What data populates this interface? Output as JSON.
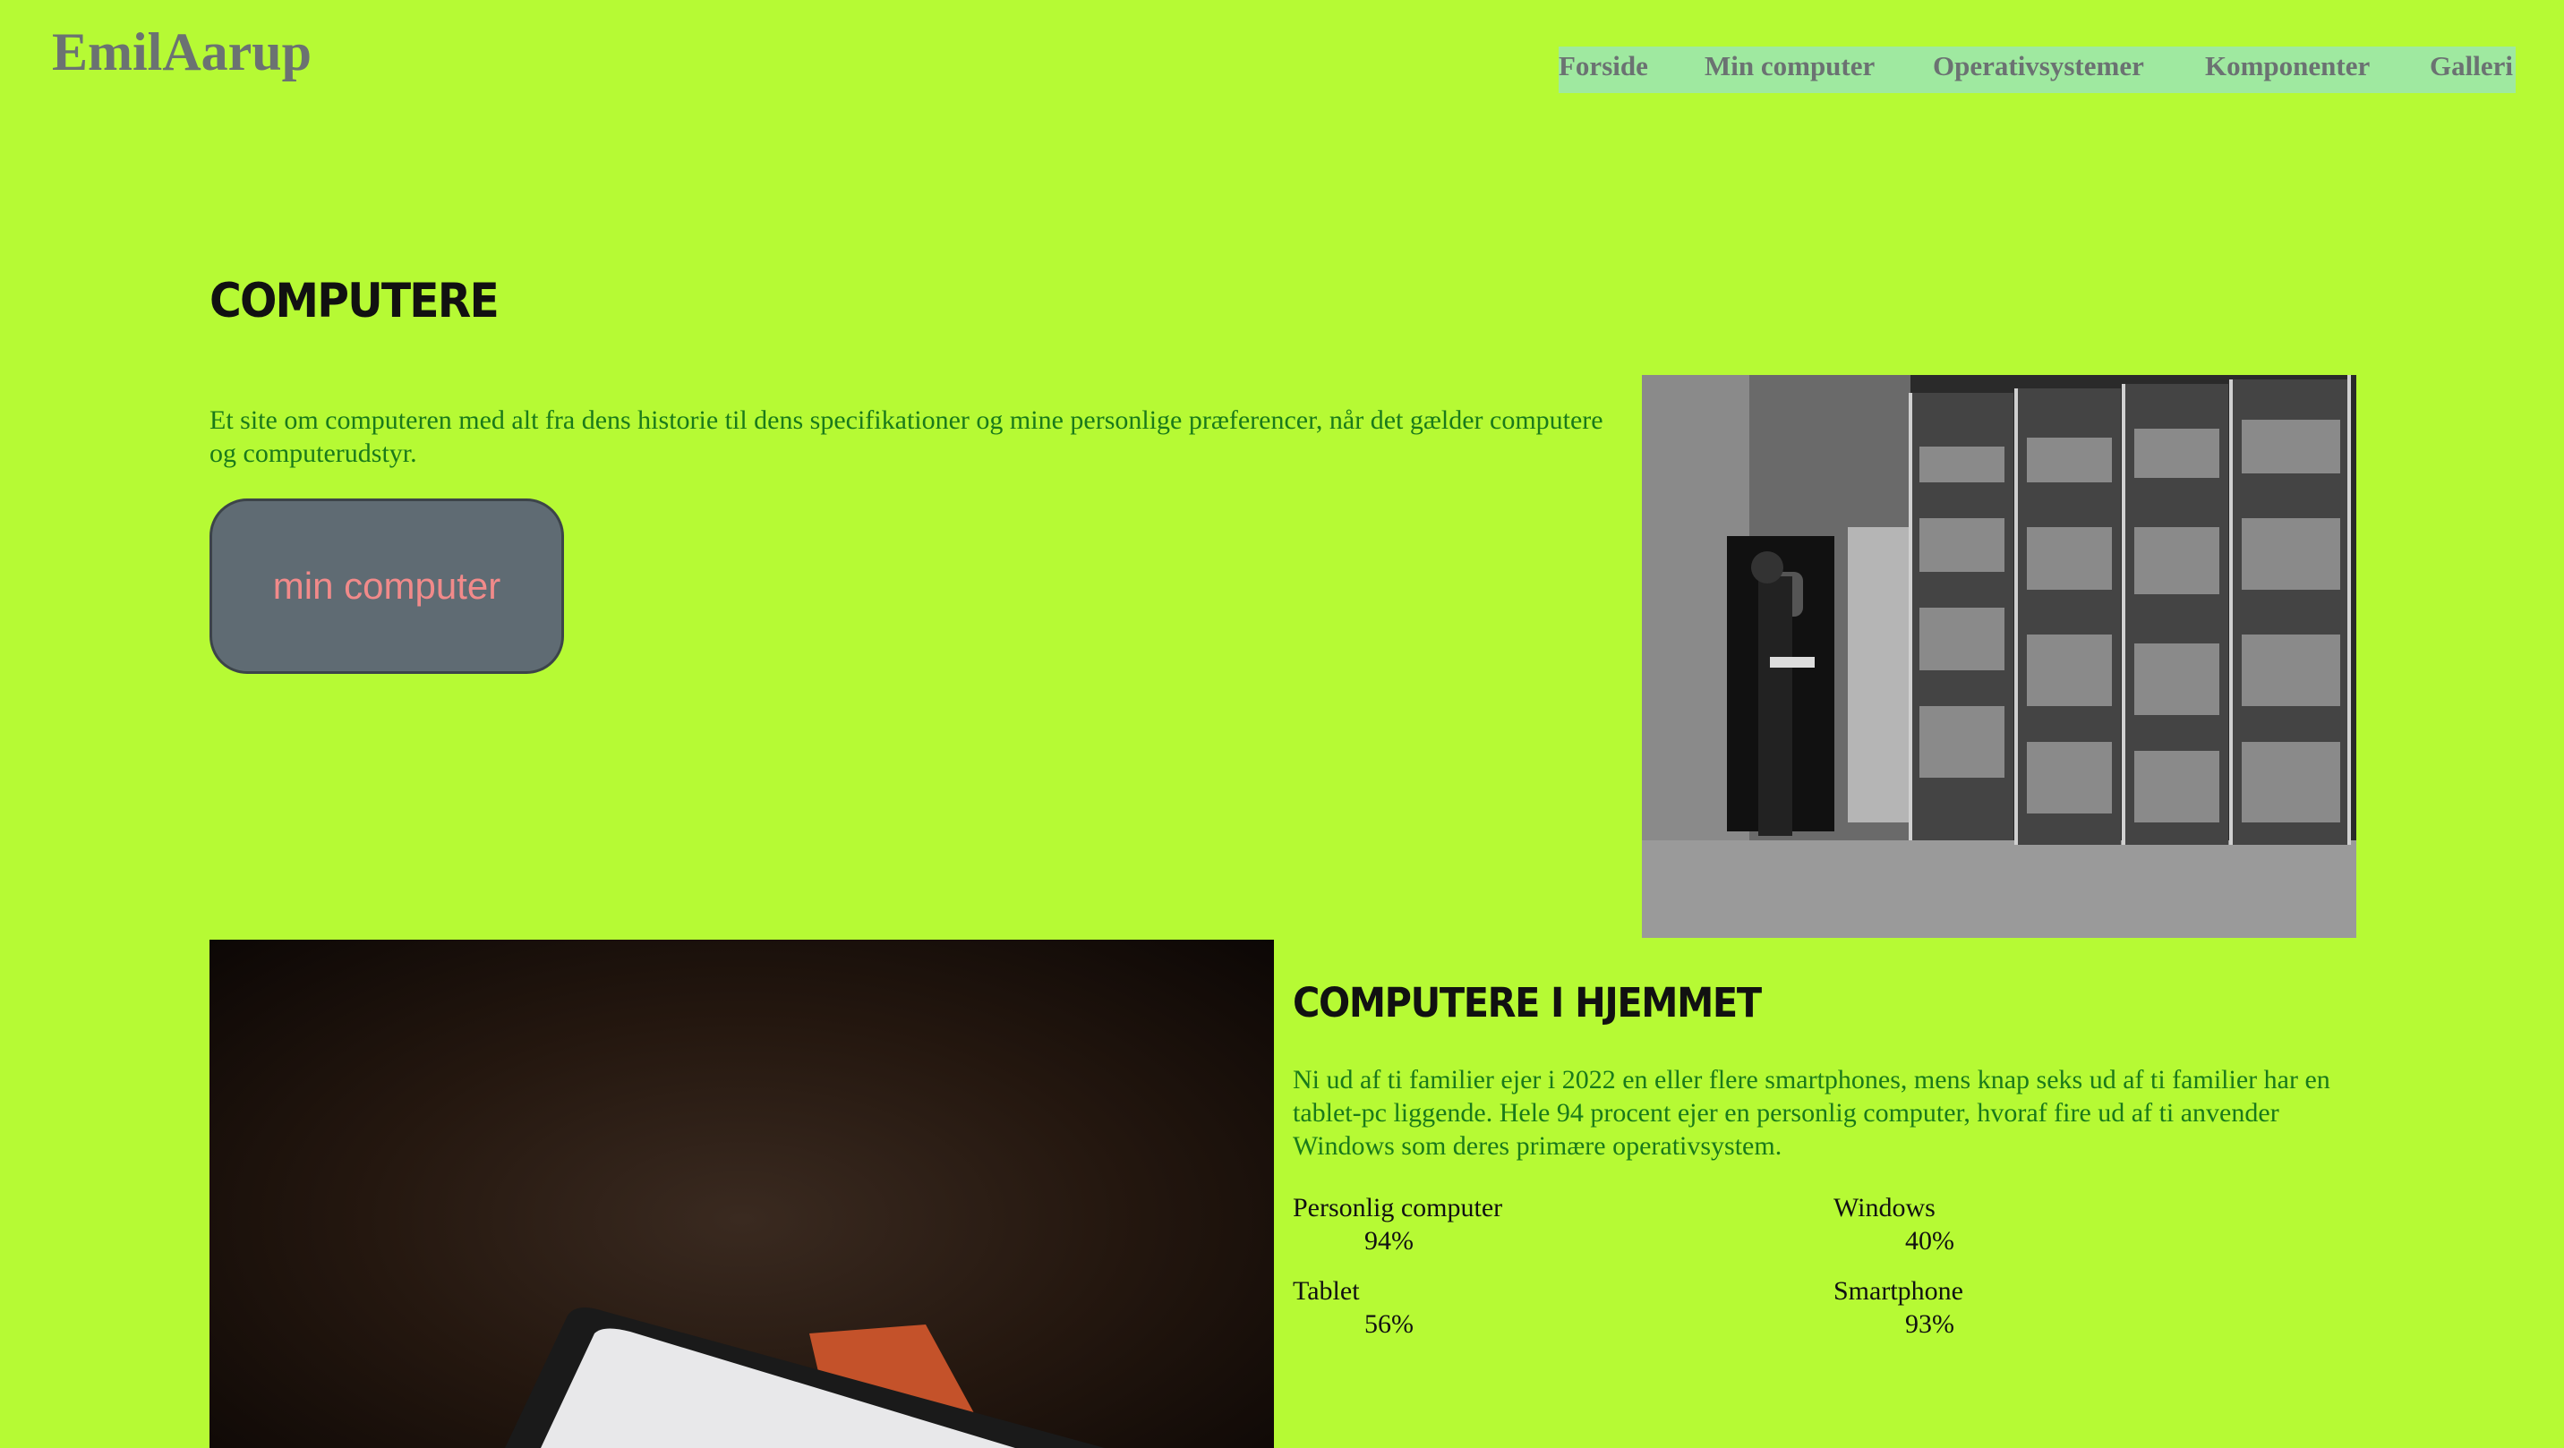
{
  "header": {
    "logo": "EmilAarup",
    "nav": [
      "Forside",
      "Min computer",
      "Operativsystemer",
      "Komponenter",
      "Galleri"
    ]
  },
  "hero": {
    "title": "COMPUTERE",
    "intro": "Et site om computeren med alt fra dens historie til dens specifikationer og mine personlige præferencer, når det gælder computere og computerudstyr.",
    "button_label": "min computer"
  },
  "home": {
    "title": "COMPUTERE I HJEMMET",
    "text": "Ni ud af ti familier ejer i 2022 en eller flere smartphones, mens knap seks ud af ti familier har en tablet-pc liggende. Hele 94 procent ejer en personlig computer, hvoraf fire ud af ti anvender Windows som deres primære operativsystem.",
    "stats": [
      {
        "label": "Personlig computer",
        "value": "94%"
      },
      {
        "label": "Windows",
        "value": "40%"
      },
      {
        "label": "Tablet",
        "value": "56%"
      },
      {
        "label": "Smartphone",
        "value": "93%"
      }
    ]
  },
  "colors": {
    "background": "#b6fa34",
    "nav_bg": "#9fe9a0",
    "text_green": "#1a7a1a",
    "button_bg": "#5f6b73",
    "button_text": "#f18a8a"
  }
}
